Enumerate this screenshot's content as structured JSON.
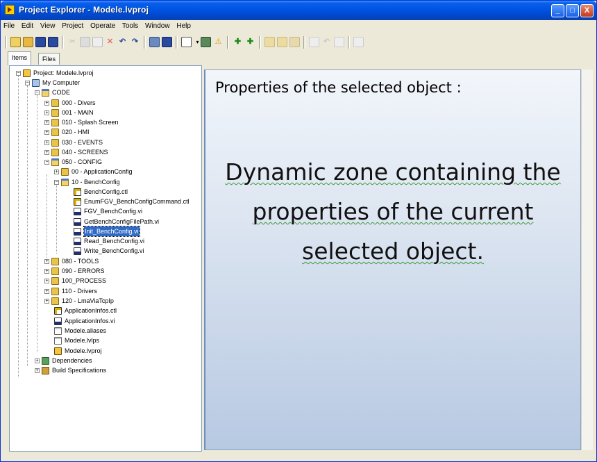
{
  "window": {
    "title": "Project Explorer - Modele.lvproj",
    "controls": [
      "_",
      "□",
      "X"
    ]
  },
  "menu": [
    "File",
    "Edit",
    "View",
    "Project",
    "Operate",
    "Tools",
    "Window",
    "Help"
  ],
  "tabs": [
    {
      "label": "Items",
      "active": true
    },
    {
      "label": "Files",
      "active": false
    }
  ],
  "tree": [
    {
      "label": "Project: Modele.lvproj",
      "icon": "project-icon",
      "expanded": true
    },
    {
      "label": "My Computer",
      "icon": "computer-icon",
      "expanded": true
    },
    {
      "label": "CODE",
      "icon": "folder-open-icon",
      "expanded": true
    },
    {
      "label": "000 - Divers",
      "icon": "folder-icon",
      "expanded": false
    },
    {
      "label": "001 - MAIN",
      "icon": "folder-icon",
      "expanded": false
    },
    {
      "label": "010 - Splash Screen",
      "icon": "folder-icon",
      "expanded": false
    },
    {
      "label": "020 - HMI",
      "icon": "folder-icon",
      "expanded": false
    },
    {
      "label": "030 - EVENTS",
      "icon": "folder-icon",
      "expanded": false
    },
    {
      "label": "040 - SCREENS",
      "icon": "folder-icon",
      "expanded": false
    },
    {
      "label": "050 - CONFIG",
      "icon": "folder-open-icon",
      "expanded": true
    },
    {
      "label": "00 - ApplicationConfig",
      "icon": "folder-icon",
      "expanded": false
    },
    {
      "label": "10 - BenchConfig",
      "icon": "folder-open-icon",
      "expanded": true
    },
    {
      "label": "BenchConfig.ctl",
      "icon": "ctl-icon"
    },
    {
      "label": "EnumFGV_BenchConfigCommand.ctl",
      "icon": "ctl-icon"
    },
    {
      "label": "FGV_BenchConfig.vi",
      "icon": "vi-icon"
    },
    {
      "label": "GetBenchConfigFilePath.vi",
      "icon": "vi-icon"
    },
    {
      "label": "Init_BenchConfig.vi",
      "icon": "vi-icon",
      "selected": true
    },
    {
      "label": "Read_BenchConfig.vi",
      "icon": "vi-icon"
    },
    {
      "label": "Write_BenchConfig.vi",
      "icon": "vi-icon"
    },
    {
      "label": "080 - TOOLS",
      "icon": "folder-icon",
      "expanded": false
    },
    {
      "label": "090 - ERRORS",
      "icon": "folder-icon",
      "expanded": false
    },
    {
      "label": "100_PROCESS",
      "icon": "folder-icon",
      "expanded": false
    },
    {
      "label": "110 - Drivers",
      "icon": "folder-icon",
      "expanded": false
    },
    {
      "label": "120 - LmaViaTcpIp",
      "icon": "folder-icon",
      "expanded": false
    },
    {
      "label": "ApplicationInfos.ctl",
      "icon": "ctl-icon"
    },
    {
      "label": "ApplicationInfos.vi",
      "icon": "vi-icon"
    },
    {
      "label": "Modele.aliases",
      "icon": "file-icon"
    },
    {
      "label": "Modele.lvlps",
      "icon": "file-icon"
    },
    {
      "label": "Modele.lvproj",
      "icon": "project-icon"
    },
    {
      "label": "Dependencies",
      "icon": "dependencies-icon",
      "expanded": false
    },
    {
      "label": "Build Specifications",
      "icon": "build-icon",
      "expanded": false
    }
  ],
  "properties": {
    "title": "Properties of the selected object :",
    "dynamic_lines": [
      "Dynamic zone containing the",
      "properties of the current",
      "selected object."
    ]
  },
  "colors": {
    "titlebar": "#0054e3",
    "selection": "#316ac5",
    "panel_bottom": "#b7c9e2"
  }
}
